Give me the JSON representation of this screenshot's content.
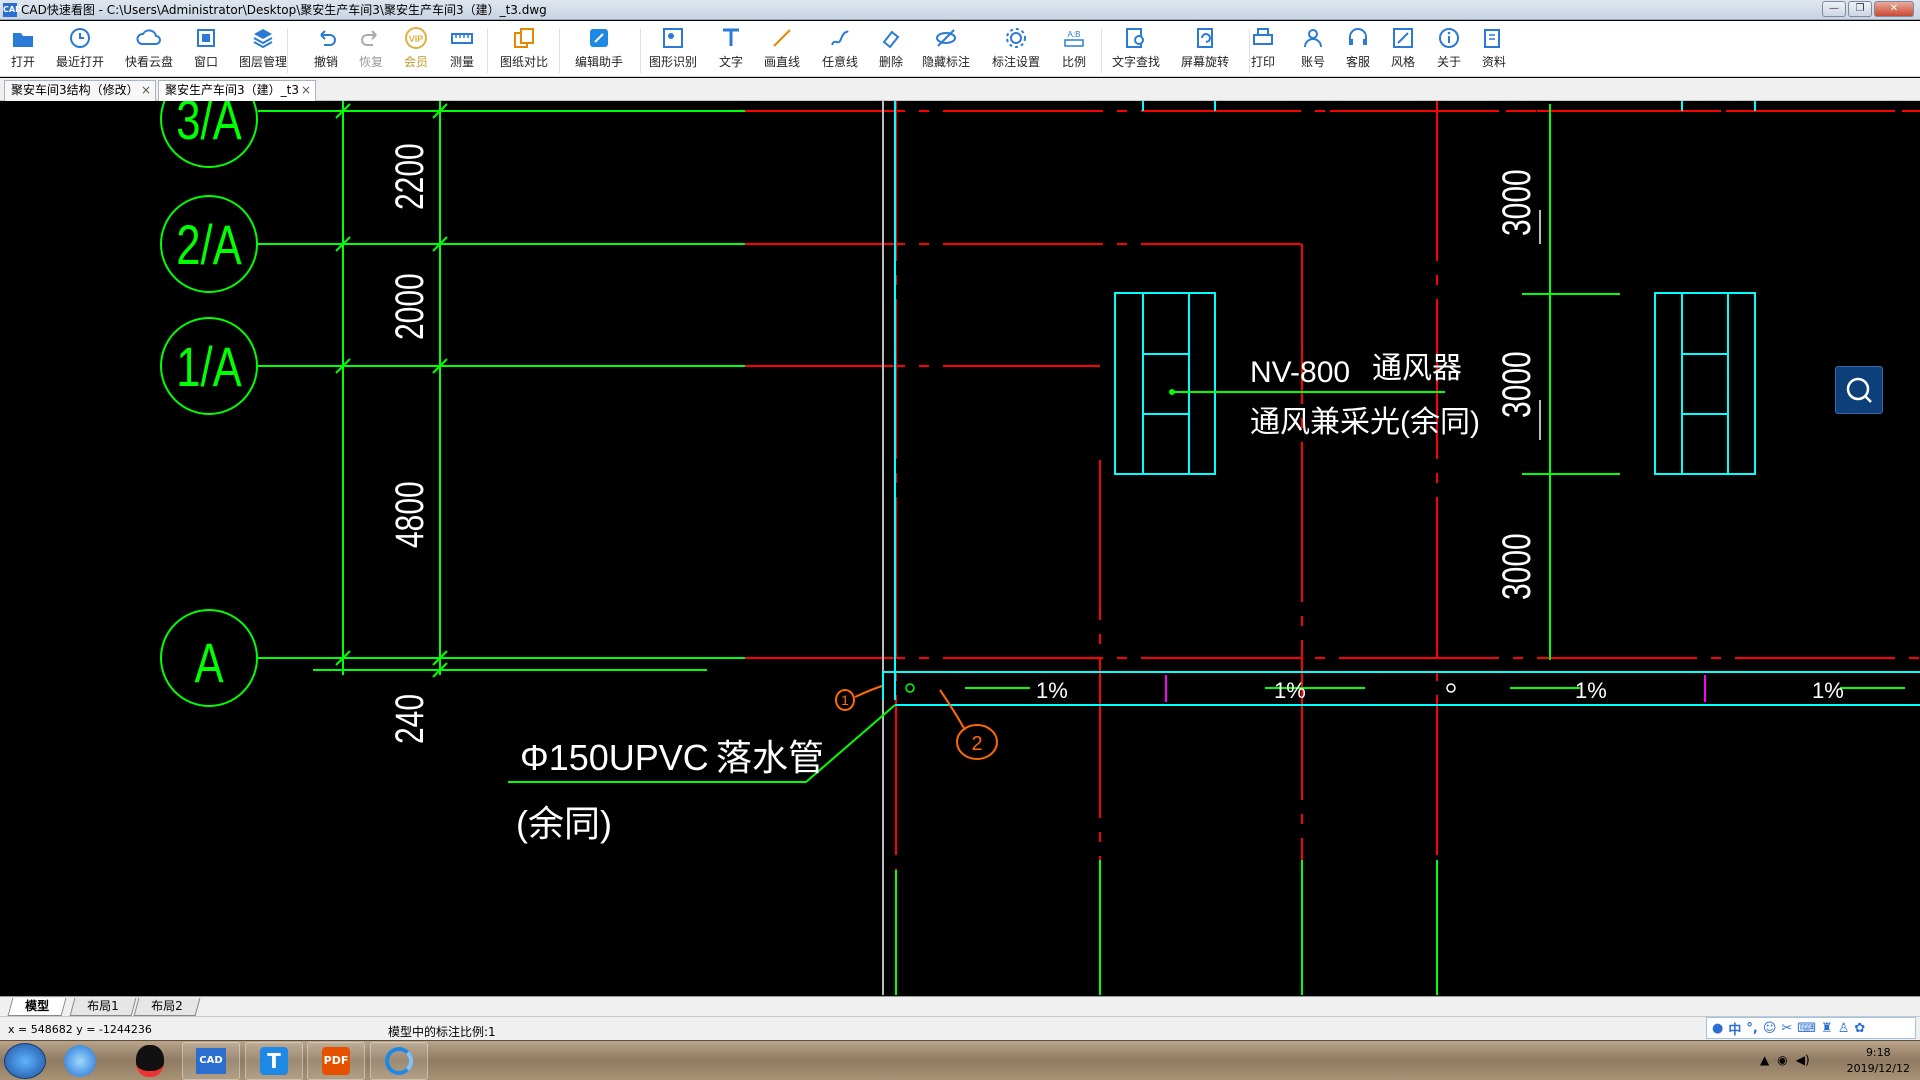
{
  "window": {
    "title": "CAD快速看图 - C:\\Users\\Administrator\\Desktop\\聚安生产车间3\\聚安生产车间3（建）_t3.dwg"
  },
  "toolbar": {
    "items": [
      {
        "label": "打开",
        "icon": "folder-open-icon"
      },
      {
        "label": "最近打开",
        "icon": "recent-icon"
      },
      {
        "label": "快看云盘",
        "icon": "cloud-icon"
      },
      {
        "label": "窗口",
        "icon": "window-icon"
      },
      {
        "label": "图层管理",
        "icon": "layers-icon"
      },
      {
        "label": "撤销",
        "icon": "undo-icon"
      },
      {
        "label": "恢复",
        "icon": "redo-icon"
      },
      {
        "label": "会员",
        "icon": "vip-icon"
      },
      {
        "label": "测量",
        "icon": "measure-icon"
      },
      {
        "label": "图纸对比",
        "icon": "compare-icon"
      },
      {
        "label": "编辑助手",
        "icon": "edit-assistant-icon"
      },
      {
        "label": "图形识别",
        "icon": "shape-recognize-icon"
      },
      {
        "label": "文字",
        "icon": "text-icon"
      },
      {
        "label": "画直线",
        "icon": "line-icon"
      },
      {
        "label": "任意线",
        "icon": "freehand-icon"
      },
      {
        "label": "删除",
        "icon": "eraser-icon"
      },
      {
        "label": "隐藏标注",
        "icon": "hide-annotation-icon"
      },
      {
        "label": "标注设置",
        "icon": "annotation-settings-icon"
      },
      {
        "label": "比例",
        "icon": "scale-icon"
      },
      {
        "label": "文字查找",
        "icon": "text-search-icon"
      },
      {
        "label": "屏幕旋转",
        "icon": "rotate-screen-icon"
      },
      {
        "label": "打印",
        "icon": "print-icon"
      },
      {
        "label": "账号",
        "icon": "account-icon"
      },
      {
        "label": "客服",
        "icon": "support-icon"
      },
      {
        "label": "风格",
        "icon": "style-icon"
      },
      {
        "label": "关于",
        "icon": "about-icon"
      },
      {
        "label": "资料",
        "icon": "resources-icon"
      }
    ]
  },
  "tabs": [
    {
      "label": "聚安车间3结构（修改）",
      "close": "×"
    },
    {
      "label": "聚安生产车间3（建）_t3",
      "close": "×"
    }
  ],
  "drawing": {
    "axis_labels": [
      "3/A",
      "2/A",
      "1/A",
      "A"
    ],
    "left_dims": [
      "2200",
      "2000",
      "4800",
      "240"
    ],
    "right_dims": [
      "3000",
      "3000",
      "3000"
    ],
    "slopes": [
      "1%",
      "1%",
      "1%",
      "1%"
    ],
    "note_model": "NV-800",
    "note_name": "通风器",
    "note_desc": "通风兼采光(余同)",
    "pipe_spec": "Φ150UPVC",
    "pipe_name": "落水管",
    "pipe_note": "(余同)",
    "markup_1": "1",
    "markup_2": "2"
  },
  "colors": {
    "axis": "#00ff00",
    "red": "#ff0000",
    "cyan": "#00ffff",
    "white": "#ffffff",
    "markup": "#ff6a00",
    "magenta": "#ff00ff"
  },
  "layout_tabs": [
    "模型",
    "布局1",
    "布局2"
  ],
  "status": {
    "coords": "x = 548682  y = -1244236",
    "scale": "模型中的标注比例:1"
  },
  "ime": {
    "lang": "中"
  },
  "taskbar": {
    "apps": [
      "start-orb",
      "ie-browser",
      "qq",
      "cad-viewer",
      "t-app",
      "pdf-app",
      "swirl-app"
    ]
  },
  "clock": {
    "time": "9:18",
    "date": "2019/12/12"
  }
}
